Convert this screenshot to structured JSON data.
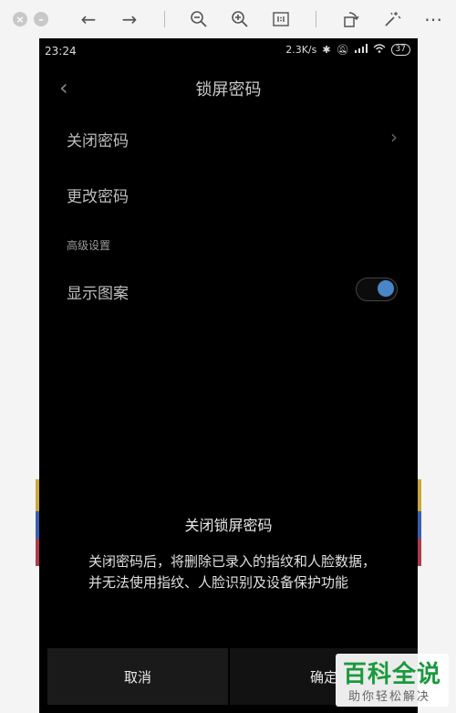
{
  "viewer_toolbar": {
    "icons": [
      "close-icon",
      "minimize-icon",
      "arrow-left-icon",
      "arrow-right-icon",
      "zoom-out-icon",
      "zoom-in-icon",
      "actual-size-icon",
      "rotate-icon",
      "magic-wand-icon",
      "more-icon"
    ]
  },
  "status_bar": {
    "time": "23:24",
    "network_speed": "2.3K/s",
    "battery": "37"
  },
  "header": {
    "title": "锁屏密码"
  },
  "settings": {
    "close_password": "关闭密码",
    "change_password": "更改密码",
    "section_advanced": "高级设置",
    "show_pattern": "显示图案",
    "show_pattern_enabled": true
  },
  "dialog": {
    "title": "关闭锁屏密码",
    "message": "关闭密码后，将删除已录入的指纹和人脸数据，并无法使用指纹、人脸识别及设备保护功能",
    "cancel_label": "取消",
    "confirm_label": "确定"
  },
  "watermark": {
    "main": "百科全说",
    "sub": "助你轻松解决"
  },
  "colors": {
    "toggle_on": "#4a86c7",
    "watermark_green": "#1a9a3c"
  }
}
